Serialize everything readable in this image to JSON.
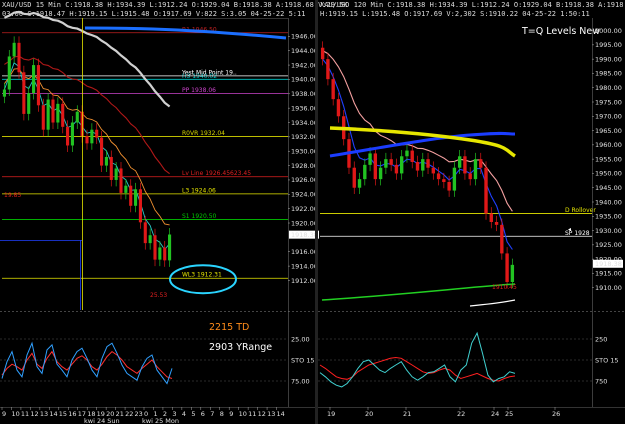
{
  "charts": {
    "left": {
      "header": "XAU/USD  15 Min  C:1918.38  H:1934.39  L:1912.24  O:1929.04  B:1918.38  A:1918.68  V:29.5K",
      "subheader": "03.00  C:1918.47  H:1919.15  L:1915.48  O:1917.69  V:822  S:3.05  04-25-22  5:11"
    },
    "right": {
      "header": "XAU/USD  120 Min  C:1918.38  H:1934.39  L:1912.24  O:1929.04  B:1918.38  A:1918.68  V:29.5K",
      "subheader": "H:1919.15  L:1915.48  O:1917.69  V:2,302  S:1910.22  04-25-22  1:50:11",
      "title": "T=Q Levels New"
    }
  },
  "colors": {
    "up": "#22c322",
    "down": "#e01818",
    "ema_fast": "#28c8c8",
    "ema_slow": "#f09030",
    "yellow_level": "#e6e600",
    "bg": "#000000"
  },
  "chart_data": [
    {
      "type": "line",
      "title": "XAU/USD 15 Min",
      "panel": "left-price",
      "ylim": [
        1909,
        1948
      ],
      "y_ticks": [
        "1946.00",
        "1944.00",
        "1942.00",
        "1940.00",
        "1938.00",
        "1936.00",
        "1934.00",
        "1932.00",
        "1930.00",
        "1928.00",
        "1926.00",
        "1924.00",
        "1922.00",
        "1920.00",
        "1918.38",
        "1916.00",
        "1914.00",
        "1912.00"
      ],
      "y_tick_values": [
        1946,
        1944,
        1942,
        1940,
        1938,
        1936,
        1934,
        1932,
        1930,
        1928,
        1926,
        1924,
        1922,
        1920,
        1918.38,
        1916,
        1914,
        1912
      ],
      "x_ticks": [
        "9",
        "10",
        "11",
        "12",
        "13",
        "14",
        "15",
        "16",
        "17",
        "18",
        "19",
        "20",
        "21",
        "22",
        "23",
        "0",
        "1",
        "2",
        "3",
        "4",
        "5",
        "6",
        "7",
        "8",
        "9",
        "10",
        "11",
        "12",
        "13",
        "14"
      ],
      "x_group_labels": [
        "kwi 24 Sun",
        "kwi 25 Mon"
      ],
      "levels": [
        {
          "label": "R1 1946.50",
          "value": 1946.5,
          "color": "#c02020"
        },
        {
          "label": "H3 1940.02",
          "value": 1940.02,
          "color": "#00c8c8"
        },
        {
          "label": "Yest Mid Point 19..",
          "value": 1940.5,
          "color": "#ffffff"
        },
        {
          "label": "PP 1938.06",
          "value": 1938.06,
          "color": "#cc44cc"
        },
        {
          "label": "R0VR 1932.04",
          "value": 1932.04,
          "color": "#d8d800"
        },
        {
          "label": "Lv Line 1926.45623.45",
          "value": 1926.45,
          "color": "#e02020"
        },
        {
          "label": "L3 1924.06",
          "value": 1924.06,
          "color": "#e8e800"
        },
        {
          "label": "S1 1920.50",
          "value": 1920.5,
          "color": "#00c800"
        },
        {
          "label": "WL3 1912.31",
          "value": 1912.31,
          "color": "#e8e800"
        }
      ],
      "annotations": [
        "19.85",
        "25.53"
      ],
      "close": [
        1938.6,
        1943.2,
        1945.1,
        1941.0,
        1935.2,
        1938.1,
        1942.0,
        1936.4,
        1933.0,
        1937.2,
        1934.0,
        1936.6,
        1933.4,
        1930.8,
        1934.0,
        1935.5,
        1932.1,
        1931.1,
        1933.0,
        1931.9,
        1928.0,
        1929.2,
        1926.0,
        1927.6,
        1924.2,
        1925.2,
        1922.4,
        1924.7,
        1920.1,
        1917.2,
        1918.3,
        1914.9,
        1916.6,
        1914.8,
        1918.4
      ]
    },
    {
      "type": "line",
      "panel": "left-oscillator",
      "annotations": [
        "2215 TD",
        "2903 YRange"
      ],
      "y_ticks": [
        "25.00",
        "STO 15",
        "75.00"
      ],
      "y_tick_values": [
        25,
        50,
        75
      ],
      "series": [
        {
          "name": "",
          "color": "#ff3030",
          "values": [
            68,
            60,
            55,
            58,
            62,
            50,
            42,
            55,
            60,
            48,
            40,
            52,
            58,
            62,
            55,
            48,
            45,
            50,
            58,
            62,
            55,
            46,
            40,
            44,
            50,
            58,
            62,
            66,
            60,
            55,
            50,
            58,
            64,
            70,
            72
          ]
        },
        {
          "name": "",
          "color": "#30a0ff",
          "values": [
            72,
            52,
            40,
            62,
            70,
            44,
            30,
            58,
            66,
            38,
            32,
            55,
            62,
            70,
            50,
            40,
            36,
            48,
            62,
            70,
            48,
            34,
            30,
            42,
            56,
            66,
            70,
            74,
            58,
            48,
            44,
            62,
            70,
            78,
            60
          ]
        }
      ]
    },
    {
      "type": "line",
      "title": "XAU/USD 120 Min",
      "panel": "right-price",
      "ylim": [
        1905,
        2003
      ],
      "y_ticks": [
        "2000.00",
        "1995.00",
        "1990.00",
        "1985.00",
        "1980.00",
        "1975.00",
        "1970.00",
        "1965.00",
        "1960.00",
        "1955.00",
        "1950.00",
        "1945.00",
        "1940.00",
        "1935.00",
        "1930.00",
        "1925.00",
        "1920.00",
        "1918.38",
        "1915.00",
        "1910.00"
      ],
      "y_tick_values": [
        2000,
        1995,
        1990,
        1985,
        1980,
        1975,
        1970,
        1965,
        1960,
        1955,
        1950,
        1945,
        1940,
        1935,
        1930,
        1925,
        1920,
        1918.38,
        1915,
        1910
      ],
      "x_ticks": [
        "19",
        "20",
        "21",
        "22",
        "24",
        "25",
        "26"
      ],
      "levels": [
        {
          "label": "D Rollover",
          "value": 1936.0,
          "color": "#e8e800"
        },
        {
          "label": "SP 1928",
          "value": 1928.0,
          "color": "#ffffff"
        }
      ],
      "annotations": [
        "1910.45"
      ],
      "close": [
        1990,
        1983,
        1976,
        1970,
        1962,
        1952,
        1945,
        1948,
        1953,
        1957,
        1948,
        1952,
        1955,
        1953,
        1950,
        1956,
        1958,
        1954,
        1951,
        1955,
        1952,
        1950,
        1948,
        1947,
        1944,
        1952,
        1956,
        1950,
        1948,
        1955,
        1952,
        1936,
        1933,
        1932,
        1922,
        1912,
        1918
      ]
    },
    {
      "type": "line",
      "panel": "right-oscillator",
      "y_ticks": [
        "250",
        "STO 15",
        "750"
      ],
      "y_tick_values": [
        250,
        500,
        750
      ],
      "series": [
        {
          "name": "",
          "color": "#ff2020",
          "values": [
            560,
            600,
            650,
            700,
            720,
            730,
            700,
            640,
            600,
            560,
            540,
            520,
            500,
            480,
            470,
            480,
            520,
            560,
            600,
            640,
            660,
            650,
            620,
            600,
            620,
            680,
            720,
            700,
            680,
            660,
            690,
            720,
            740,
            750,
            720,
            700,
            690
          ]
        },
        {
          "name": "",
          "color": "#40d0d0",
          "values": [
            650,
            700,
            760,
            800,
            820,
            780,
            700,
            600,
            520,
            500,
            560,
            620,
            650,
            600,
            560,
            520,
            620,
            700,
            740,
            700,
            650,
            640,
            600,
            560,
            700,
            760,
            620,
            560,
            300,
            180,
            420,
            680,
            760,
            720,
            700,
            640,
            660
          ]
        }
      ]
    }
  ]
}
